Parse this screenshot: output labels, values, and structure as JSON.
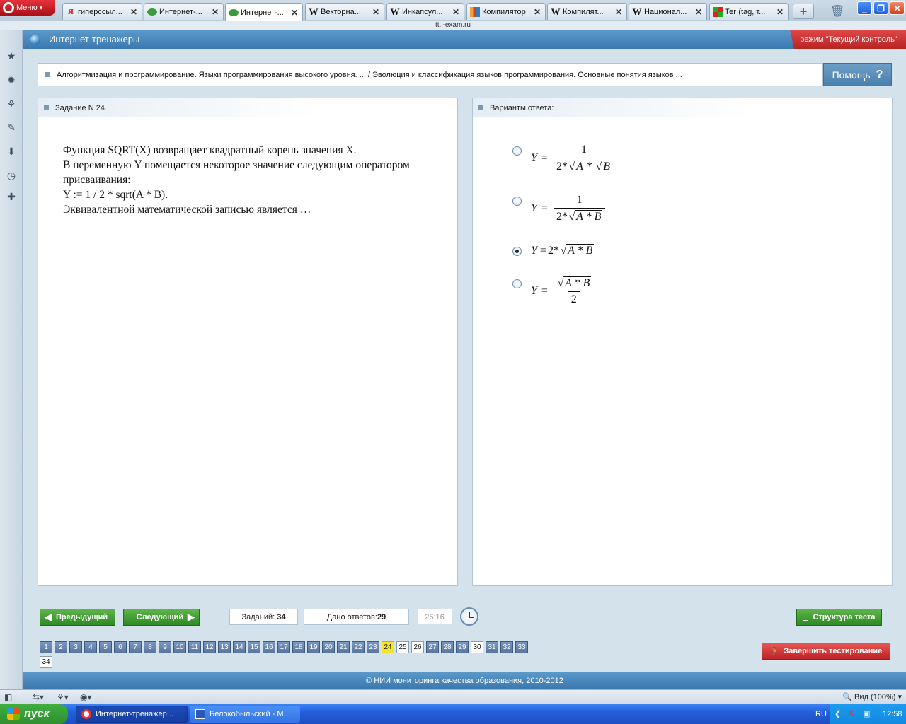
{
  "browser": {
    "menu_label": "Меню",
    "url": "tt.i-exam.ru",
    "tabs": [
      {
        "label": "гиперссыл...",
        "icon": "yandex-icon"
      },
      {
        "label": "Интернет-...",
        "icon": "i-exam-icon"
      },
      {
        "label": "Интернет-...",
        "icon": "i-exam-icon"
      },
      {
        "label": "Векторна...",
        "icon": "wikipedia-icon"
      },
      {
        "label": "Инкапсул...",
        "icon": "wikipedia-icon"
      },
      {
        "label": "Компилятор",
        "icon": "chart-icon"
      },
      {
        "label": "Компилят...",
        "icon": "wikipedia-icon"
      },
      {
        "label": "Национал...",
        "icon": "wikipedia-icon"
      },
      {
        "label": "Тег (tag, т...",
        "icon": "tag-icon"
      }
    ],
    "zoom_label": "Вид (100%)"
  },
  "app": {
    "title": "Интернет-тренажеры",
    "mode": "режим \"Текущий контроль\"",
    "breadcrumb": "Алгоритмизация и программирование. Языки программирования высокого уровня. ... / Эволюция и классификация языков программирования. Основные понятия языков ...",
    "help_label": "Помощь",
    "help_glyph": "?",
    "footer": "© НИИ мониторинга качества образования, 2010-2012"
  },
  "question": {
    "header": "Задание N 24.",
    "text": "Функция SQRT(X) возвращает квадратный корень значения X.\nВ переменную Y помещается некоторое значение следующим оператором присваивания:\nY := 1 / 2 * sqrt(A * B).\nЭквивалентной математической записью является …"
  },
  "answers": {
    "header": "Варианты ответа:",
    "selected_index": 2,
    "math": {
      "y": "Y",
      "eq": "=",
      "one": "1",
      "two": "2",
      "two_times": "2",
      "times": "*",
      "a": "A",
      "b": "B",
      "a_times_b": "A * B",
      "radical": "√"
    }
  },
  "controls": {
    "prev_label": "Предыдущий",
    "next_label": "Следующий",
    "tasks_label": "Заданий:",
    "tasks_total": "34",
    "answered_label": "Дано ответов:",
    "answered_count": "29",
    "timer": "26:16",
    "structure_label": "Структура теста",
    "finish_label": "Завершить тестирование"
  },
  "question_grid": {
    "current": 24,
    "unanswered": [
      25,
      26,
      30,
      34
    ],
    "numbers": [
      "1",
      "2",
      "3",
      "4",
      "5",
      "6",
      "7",
      "8",
      "9",
      "10",
      "11",
      "12",
      "13",
      "14",
      "15",
      "16",
      "17",
      "18",
      "19",
      "20",
      "21",
      "22",
      "23",
      "24",
      "25",
      "26",
      "27",
      "28",
      "29",
      "30",
      "31",
      "32",
      "33",
      "34"
    ]
  },
  "taskbar": {
    "start_label": "пуск",
    "items": [
      "Интернет-тренажер...",
      "Белокобыльский - М..."
    ],
    "lang": "RU",
    "clock": "12:58"
  }
}
